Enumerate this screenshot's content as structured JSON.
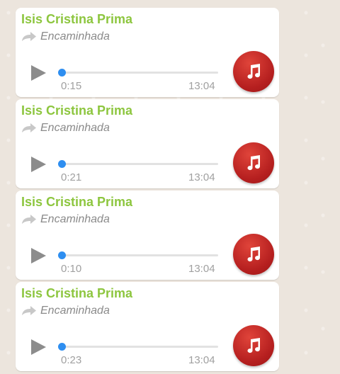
{
  "messages": [
    {
      "sender": "Isis Cristina Prima",
      "forwarded_label": "Encaminhada",
      "duration": "0:15",
      "time": "13:04",
      "progress": 0
    },
    {
      "sender": "Isis Cristina Prima",
      "forwarded_label": "Encaminhada",
      "duration": "0:21",
      "time": "13:04",
      "progress": 0
    },
    {
      "sender": "Isis Cristina Prima",
      "forwarded_label": "Encaminhada",
      "duration": "0:10",
      "time": "13:04",
      "progress": 0
    },
    {
      "sender": "Isis Cristina Prima",
      "forwarded_label": "Encaminhada",
      "duration": "0:23",
      "time": "13:04",
      "progress": 0
    }
  ],
  "icons": {
    "play": "play-icon",
    "forward": "forward-arrow-icon",
    "audio": "music-note-icon"
  },
  "colors": {
    "sender_name": "#8dc63f",
    "progress_knob": "#2e8ef0",
    "audio_badge": "#c0262b",
    "chat_background": "#ece5dd"
  }
}
